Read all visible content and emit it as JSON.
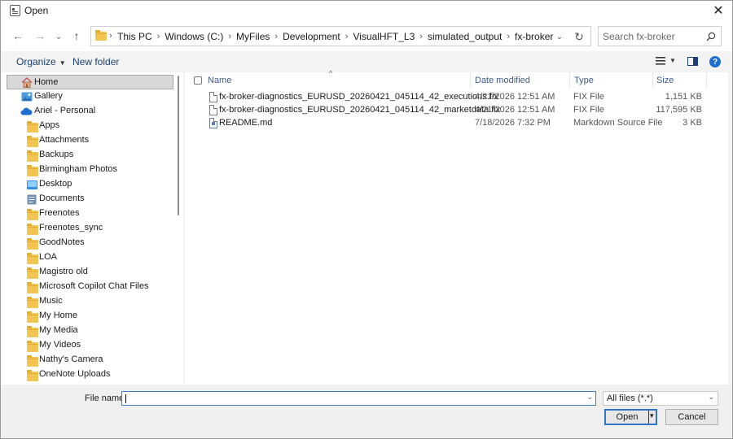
{
  "window": {
    "title": "Open",
    "close_glyph": "✕"
  },
  "nav": {
    "back_glyph": "←",
    "forward_glyph": "→",
    "recent_glyph": "⌄",
    "up_glyph": "↑",
    "breadcrumbs": [
      "This PC",
      "Windows (C:)",
      "MyFiles",
      "Development",
      "VisualHFT_L3",
      "simulated_output",
      "fx-broker"
    ],
    "crumb_separator": "›",
    "dropdown_glyph": "⌄",
    "refresh_glyph": "↻",
    "search_placeholder": "Search fx-broker"
  },
  "command_bar": {
    "organize": "Organize",
    "organize_caret": "▼",
    "new_folder": "New folder",
    "views_caret": "▼",
    "help": "?"
  },
  "sidebar": {
    "items": [
      {
        "label": "Home",
        "icon": "home-icon",
        "selected": true
      },
      {
        "label": "Gallery",
        "icon": "gallery-icon"
      },
      {
        "label": "Ariel - Personal",
        "icon": "onedrive-icon"
      },
      {
        "label": "Apps",
        "icon": "folder-icon"
      },
      {
        "label": "Attachments",
        "icon": "folder-icon"
      },
      {
        "label": "Backups",
        "icon": "folder-icon"
      },
      {
        "label": "Birmingham Photos",
        "icon": "folder-icon"
      },
      {
        "label": "Desktop",
        "icon": "desktop-icon"
      },
      {
        "label": "Documents",
        "icon": "documents-icon"
      },
      {
        "label": "Freenotes",
        "icon": "folder-icon"
      },
      {
        "label": "Freenotes_sync",
        "icon": "folder-icon"
      },
      {
        "label": "GoodNotes",
        "icon": "folder-icon"
      },
      {
        "label": "LOA",
        "icon": "folder-icon"
      },
      {
        "label": "Magistro old",
        "icon": "folder-icon"
      },
      {
        "label": "Microsoft Copilot Chat Files",
        "icon": "folder-icon"
      },
      {
        "label": "Music",
        "icon": "folder-icon"
      },
      {
        "label": "My Home",
        "icon": "folder-icon"
      },
      {
        "label": "My Media",
        "icon": "folder-icon"
      },
      {
        "label": "My Videos",
        "icon": "folder-icon"
      },
      {
        "label": "Nathy's Camera",
        "icon": "folder-icon"
      },
      {
        "label": "OneNote Uploads",
        "icon": "folder-icon"
      }
    ]
  },
  "file_list": {
    "sort_glyph": "^",
    "columns": {
      "name": "Name",
      "date": "Date modified",
      "type": "Type",
      "size": "Size"
    },
    "rows": [
      {
        "name": "fx-broker-diagnostics_EURUSD_20260421_045114_42_executions.fix",
        "date": "4/21/2026 12:51 AM",
        "type": "FIX File",
        "size": "1,151 KB",
        "icon": "fix-file-icon"
      },
      {
        "name": "fx-broker-diagnostics_EURUSD_20260421_045114_42_marketdata.fix",
        "date": "4/21/2026 12:51 AM",
        "type": "FIX File",
        "size": "117,595 KB",
        "icon": "fix-file-icon"
      },
      {
        "name": "README.md",
        "date": "7/18/2026 7:32 PM",
        "type": "Markdown Source File",
        "size": "3 KB",
        "icon": "markdown-file-icon"
      }
    ]
  },
  "footer": {
    "filename_label": "File name:",
    "filename_value": "",
    "filename_drop": "⌄",
    "filetype_value": "All files (*.*)",
    "filetype_drop": "⌄",
    "open_label": "Open",
    "open_drop": "▾",
    "cancel_label": "Cancel"
  },
  "colors": {
    "accent": "#2e74c9",
    "folder": "#f2c453",
    "selection": "#d8d8d8",
    "header_text": "#3c5a8a"
  }
}
